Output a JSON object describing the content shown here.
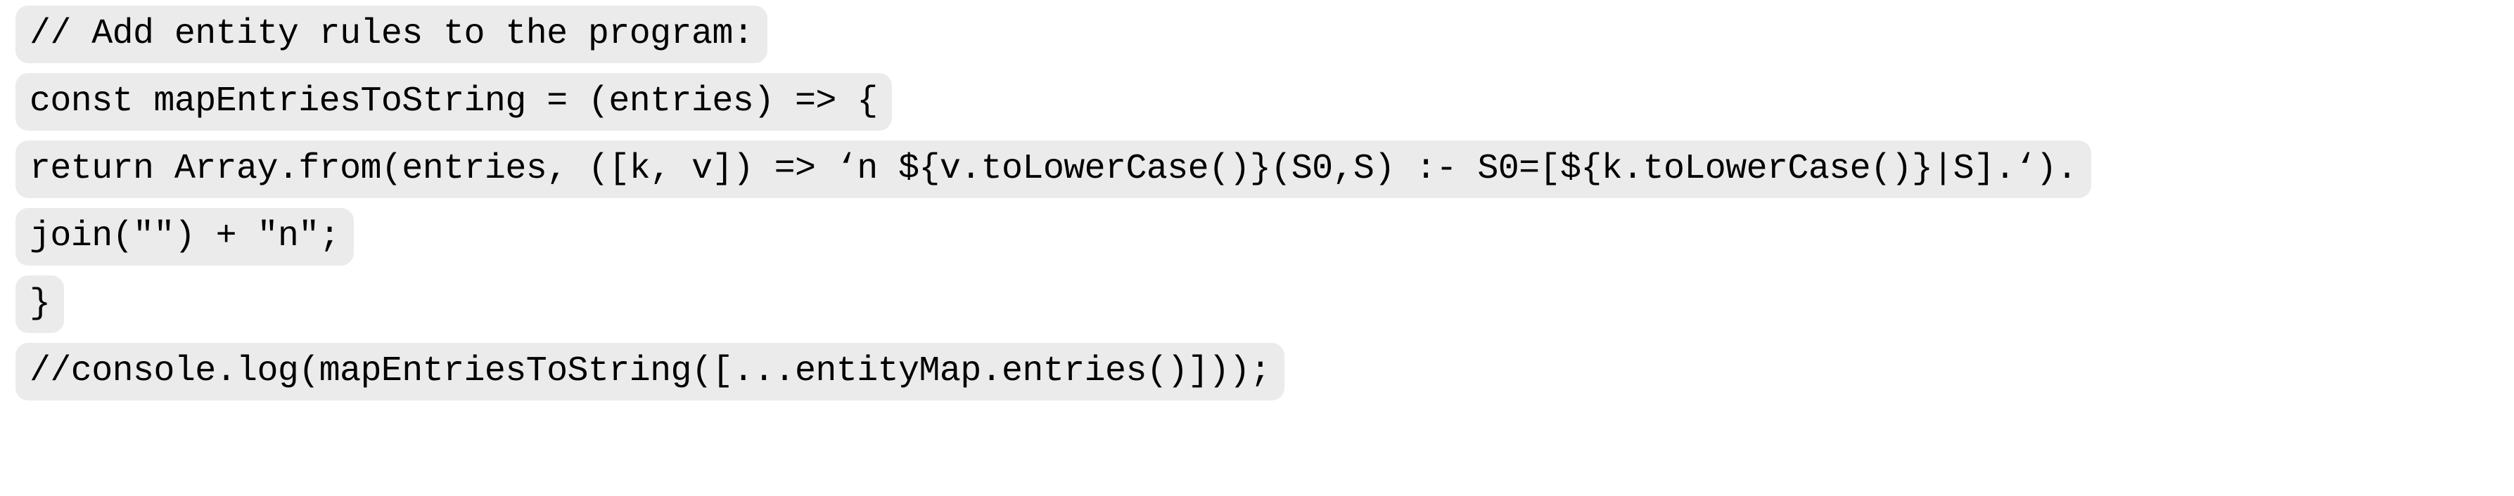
{
  "document": {
    "kind": "code-snippet",
    "language": "javascript",
    "background_color": "#ffffff",
    "line_background_color": "#ebebeb",
    "text_color": "#000000",
    "lines": [
      {
        "index": 1,
        "text": "// Add entity rules to the program:"
      },
      {
        "index": 2,
        "text": "const mapEntriesToString = (entries) => {"
      },
      {
        "index": 3,
        "text": "return Array.from(entries, ([k, v]) => ‘n ${v.toLowerCase()}(S0,S) :- S0=[${k.toLowerCase()}|S].‘)."
      },
      {
        "index": 4,
        "text": "join(\"\") + \"n\";"
      },
      {
        "index": 5,
        "text": "}"
      },
      {
        "index": 6,
        "text": "//console.log(mapEntriesToString([...entityMap.entries()]));"
      }
    ]
  }
}
